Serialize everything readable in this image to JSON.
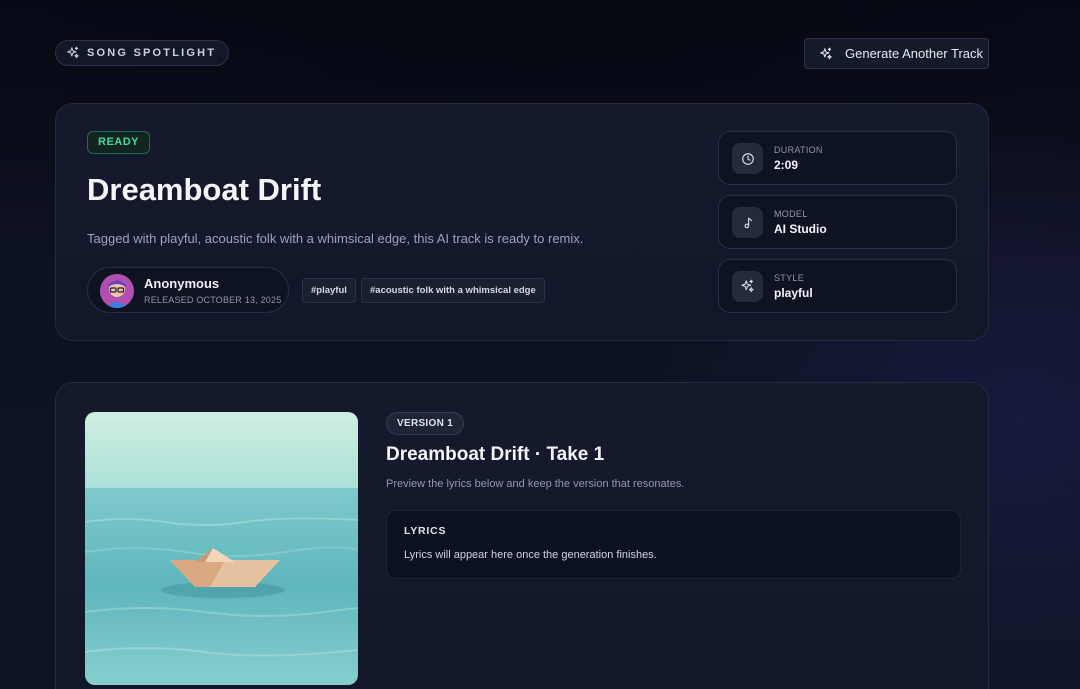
{
  "header": {
    "spotlight_label": "SONG SPOTLIGHT",
    "generate_label": "Generate Another Track"
  },
  "hero": {
    "status": "READY",
    "title": "Dreamboat Drift",
    "description": "Tagged with playful, acoustic folk with a whimsical edge, this AI track is ready to remix.",
    "artist": {
      "name": "Anonymous",
      "released": "RELEASED OCTOBER 13, 2025"
    },
    "tags": [
      "#playful",
      "#acoustic folk with a whimsical edge"
    ],
    "stats": [
      {
        "label": "DURATION",
        "value": "2:09",
        "icon": "clock-icon"
      },
      {
        "label": "MODEL",
        "value": "AI Studio",
        "icon": "music-note-icon"
      },
      {
        "label": "STYLE",
        "value": "playful",
        "icon": "sparkles-icon"
      }
    ]
  },
  "version": {
    "badge": "VERSION 1",
    "title": "Dreamboat Drift · Take 1",
    "description": "Preview the lyrics below and keep the version that resonates.",
    "lyrics_heading": "LYRICS",
    "lyrics_text": "Lyrics will appear here once the generation finishes."
  },
  "colors": {
    "accent_green": "#45d7a6",
    "background": "#0b0f1c",
    "card": "#141a2c"
  }
}
